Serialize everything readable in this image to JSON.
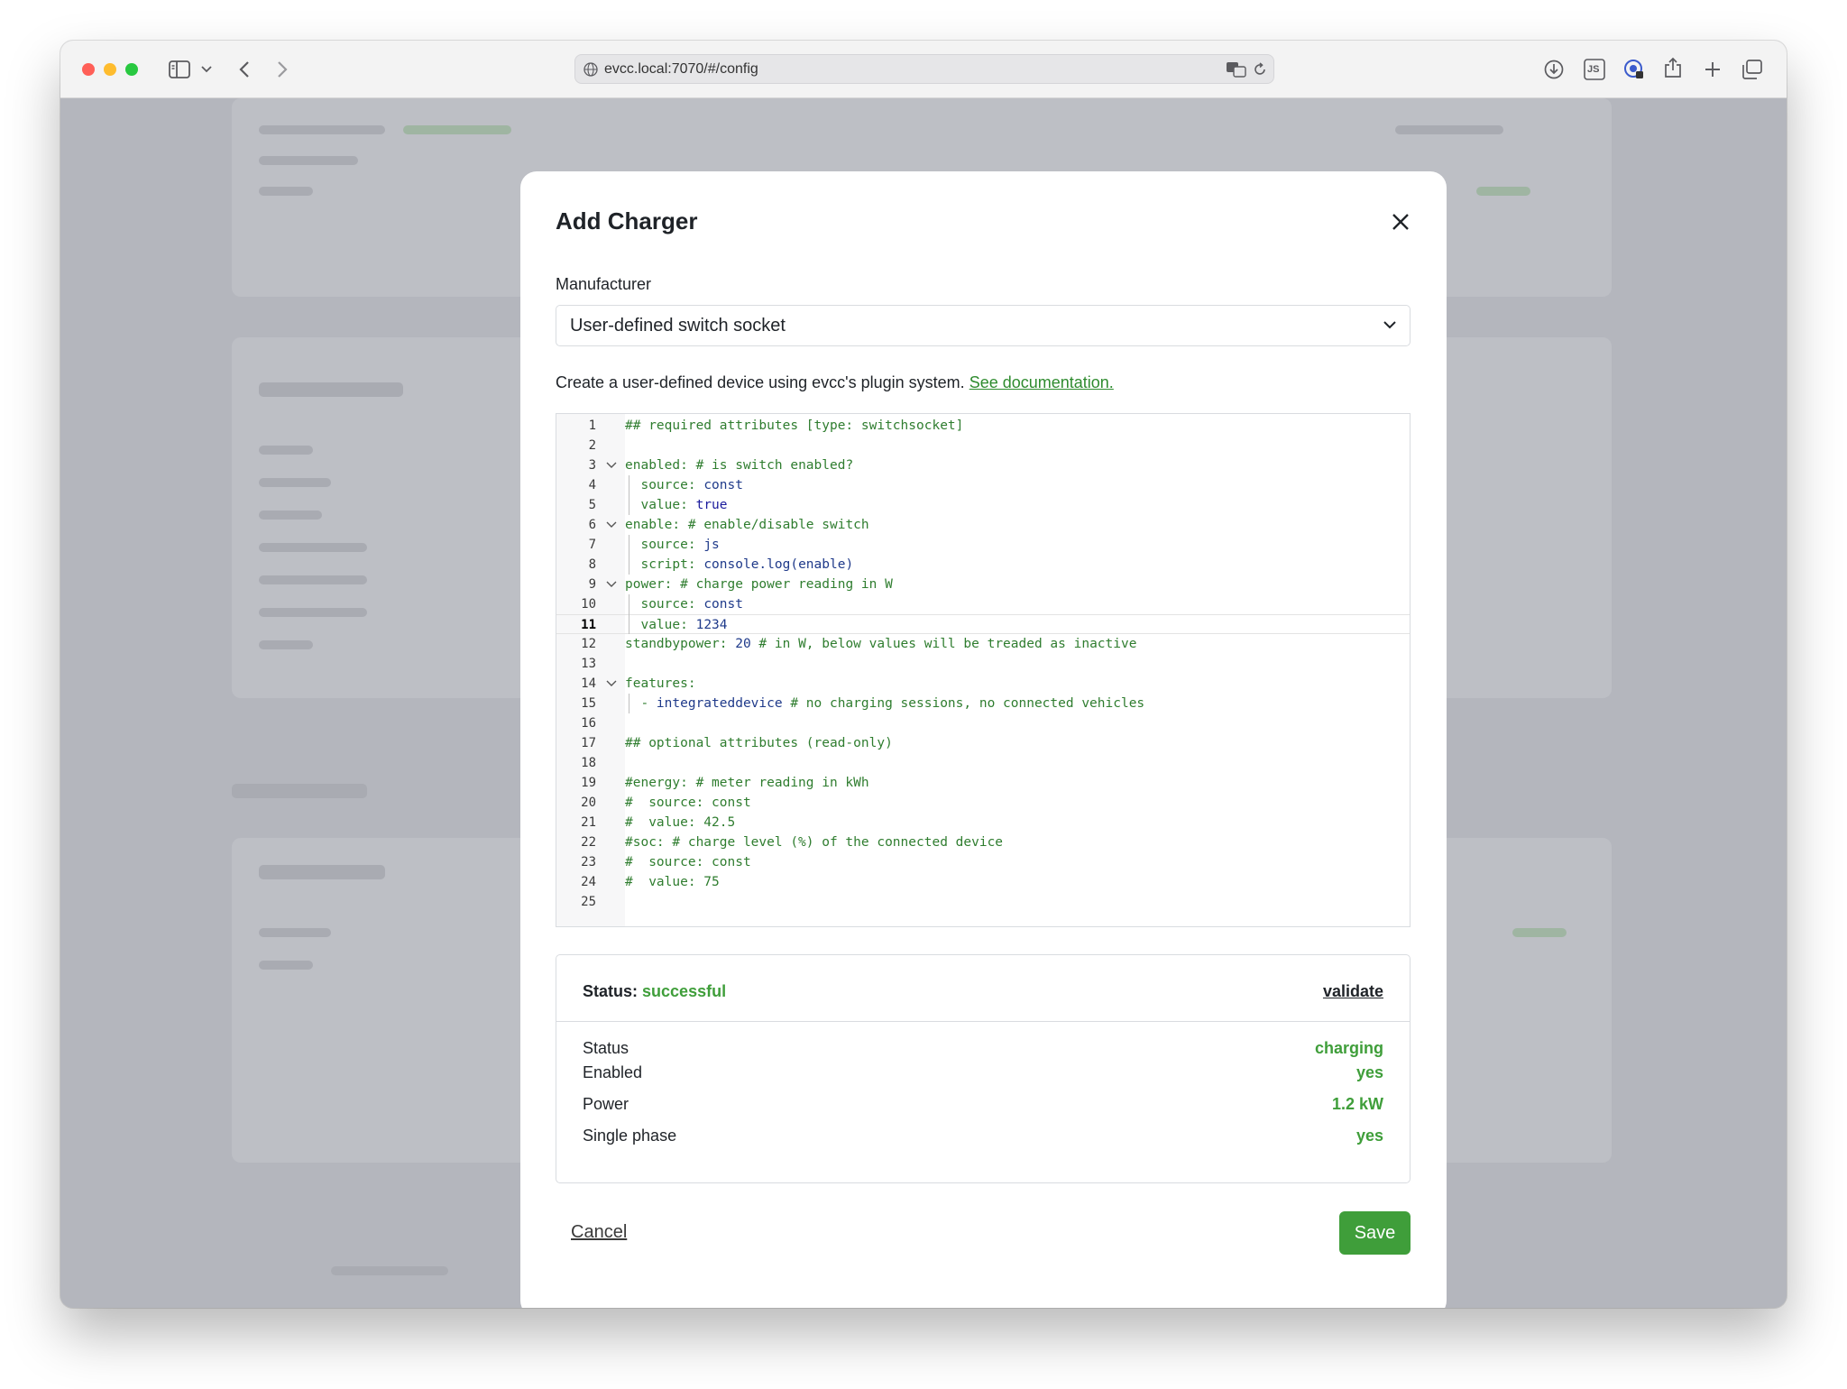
{
  "browser": {
    "url": "evcc.local:7070/#/config",
    "icons": [
      "sidebar-icon",
      "chevron-down-icon",
      "back-icon",
      "forward-icon",
      "globe-icon",
      "translate-icon",
      "reload-icon",
      "download-icon",
      "js-icon",
      "password-icon",
      "share-icon",
      "new-tab-icon",
      "tabs-overview-icon"
    ],
    "js_badge": "JS"
  },
  "modal": {
    "title": "Add Charger",
    "manufacturer_label": "Manufacturer",
    "manufacturer_value": "User-defined switch socket",
    "description": "Create a user-defined device using evcc's plugin system.",
    "description_link": "See documentation.",
    "status": {
      "label": "Status:",
      "value": "successful",
      "validate": "validate",
      "rows": [
        {
          "key": "Status",
          "value": "charging"
        },
        {
          "key": "Enabled",
          "value": "yes"
        },
        {
          "key": "Power",
          "value": "1.2 kW"
        },
        {
          "key": "Single phase",
          "value": "yes"
        }
      ]
    },
    "cancel_label": "Cancel",
    "save_label": "Save"
  },
  "editor": {
    "current_line": 11,
    "lines": [
      "## required attributes [type: switchsocket]",
      "",
      "enabled: # is switch enabled?",
      "  source: const",
      "  value: true",
      "enable: # enable/disable switch",
      "  source: js",
      "  script: console.log(enable)",
      "power: # charge power reading in W",
      "  source: const",
      "  value: 1234",
      "standbypower: 20 # in W, below values will be treaded as inactive",
      "",
      "features:",
      "  - integrateddevice # no charging sessions, no connected vehicles",
      "",
      "## optional attributes (read-only)",
      "",
      "#energy: # meter reading in kWh",
      "#  source: const",
      "#  value: 42.5",
      "#soc: # charge level (%) of the connected device",
      "#  source: const",
      "#  value: 75",
      ""
    ],
    "fold_lines": [
      3,
      6,
      9,
      14
    ]
  },
  "colors": {
    "accent": "#3f9e3a",
    "overlay": "#b4b6bd"
  }
}
